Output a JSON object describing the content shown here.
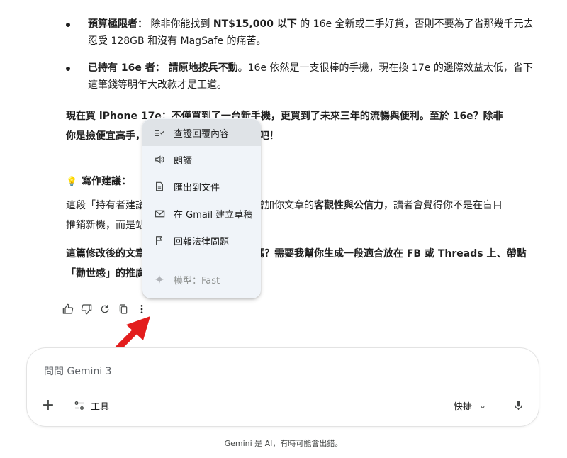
{
  "response": {
    "bullets": [
      {
        "bold": "預算極限者：",
        "text_before": " 除非你能找到 ",
        "strong": "NT$15,000 以下",
        "text_after": " 的 16e 全新或二手好貨，否則不要為了省那幾千元去忍受 128GB 和沒有 MagSafe 的痛苦。"
      },
      {
        "bold": "已持有 16e 者：",
        "strong": " 請原地按兵不動",
        "text_after": "。16e 依然是一支很棒的手機，現在換 17e 的邊際效益太低，省下這筆錢等明年大改款才是王道。"
      }
    ],
    "summary_line1": "現在買 iPhone 17e：不僅買到了一台新手機，更買到了未來三年的流暢與便利。至於 16e？除非",
    "summary_line2": "你是撿便宜高手，否則就讓它留在 2025 年吧！",
    "tip_heading": "寫作建議：",
    "tip_line1_a": "這段「持有者建議」加入了客觀的對比，能增加你文章的",
    "tip_line1_b": "客觀性與公信力",
    "tip_line1_c": "，讀者會覺得你不是在盲目",
    "tip_line2": "推銷新機，而是站在消費者的角度思考。",
    "followup_line1": "這篇修改後的文章，你覺得還需要補充什麼嗎？需要我幫你生成一段適合放在 FB 或 Threads 上、帶點",
    "followup_line2": "「勸世感」的推廣文案嗎？"
  },
  "menu": {
    "items": [
      {
        "label": "查證回覆內容",
        "icon": "double-check-icon"
      },
      {
        "label": "朗讀",
        "icon": "speaker-icon"
      },
      {
        "label": "匯出到文件",
        "icon": "document-icon"
      },
      {
        "label": "在 Gmail 建立草稿",
        "icon": "gmail-icon"
      },
      {
        "label": "回報法律問題",
        "icon": "flag-icon"
      }
    ],
    "model_label": "模型：Fast"
  },
  "input": {
    "placeholder": "問問 Gemini 3",
    "tools_label": "工具",
    "mode_label": "快捷"
  },
  "footer": "Gemini 是 AI，有時可能會出錯。",
  "colors": {
    "accent_arrow": "#e31d1d",
    "menu_bg": "#f0f4f9",
    "bulb": "#f4b400"
  }
}
